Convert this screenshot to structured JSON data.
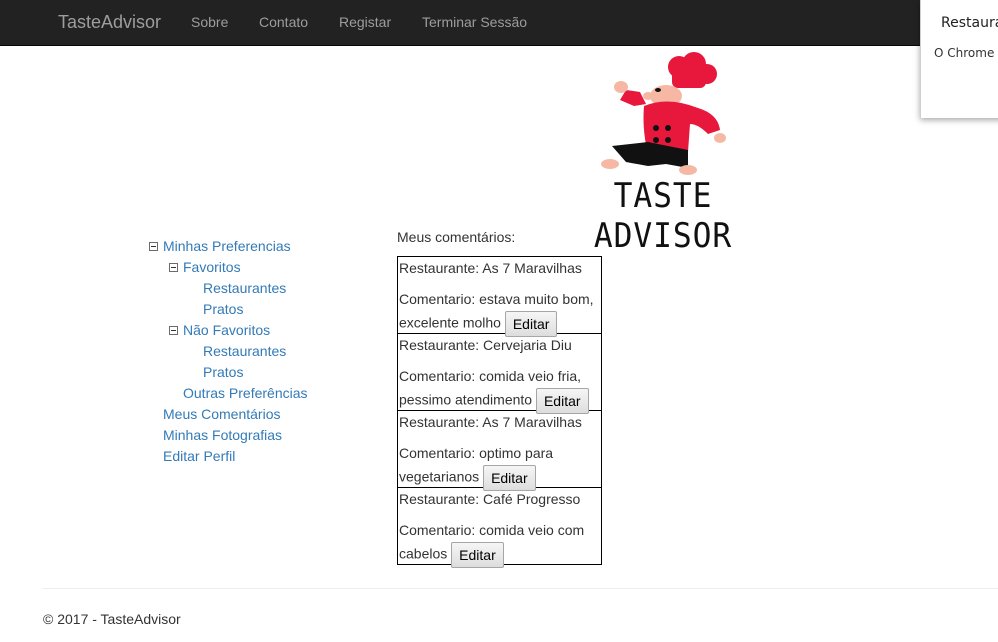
{
  "navbar": {
    "brand": "TasteAdvisor",
    "items": [
      "Sobre",
      "Contato",
      "Registar",
      "Terminar Sessão"
    ]
  },
  "popup": {
    "title": "Restaura",
    "text": "O Chrome n"
  },
  "logo": {
    "text": "TASTE ADVISOR",
    "colors": {
      "red": "#e8183c",
      "black": "#111111",
      "skin": "#f6b8a5"
    }
  },
  "tree": {
    "minhas_preferencias": "Minhas Preferencias",
    "favoritos": "Favoritos",
    "fav_restaurantes": "Restaurantes",
    "fav_pratos": "Pratos",
    "nao_favoritos": "Não Favoritos",
    "nfav_restaurantes": "Restaurantes",
    "nfav_pratos": "Pratos",
    "outras_preferencias": "Outras Preferências",
    "meus_comentarios": "Meus Comentários",
    "minhas_fotografias": "Minhas Fotografias",
    "editar_perfil": "Editar Perfil"
  },
  "comments": {
    "title": "Meus comentários:",
    "edit_label": "Editar",
    "items": [
      {
        "restaurant": "Restaurante: As 7 Maravilhas",
        "comment": "Comentario: estava muito bom, excelente molho"
      },
      {
        "restaurant": "Restaurante: Cervejaria Diu",
        "comment": "Comentario: comida veio fria, pessimo atendimento"
      },
      {
        "restaurant": "Restaurante: As 7 Maravilhas",
        "comment": "Comentario: optimo para vegetarianos"
      },
      {
        "restaurant": "Restaurante: Café Progresso",
        "comment": "Comentario: comida veio com cabelos"
      }
    ]
  },
  "footer": {
    "text": "© 2017 - TasteAdvisor"
  },
  "colors": {
    "navbar_bg": "#222222",
    "nav_text": "#9d9d9d",
    "link": "#337ab7"
  }
}
